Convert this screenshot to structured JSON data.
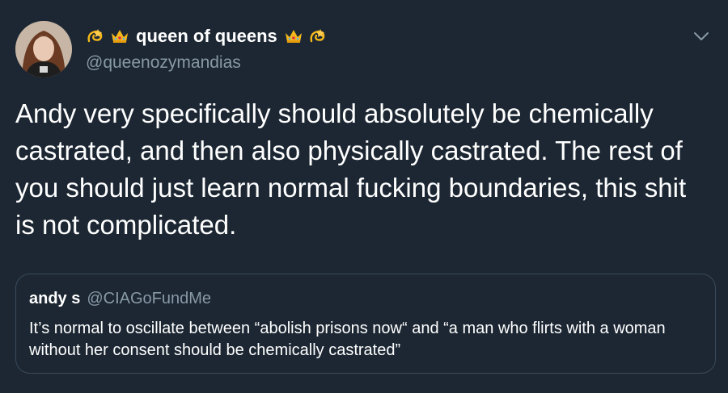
{
  "author": {
    "display_name": "queen of queens",
    "handle": "@queenozymandias",
    "avatar_icon": "profile-photo",
    "name_emojis": [
      "dizzy-star-icon",
      "crown-icon",
      "crown-icon",
      "dizzy-star-icon"
    ]
  },
  "tweet": {
    "text": "Andy very specifically should absolutely be chemically castrated, and then also physically castrated. The rest of you should just learn normal fucking boundaries, this shit is not complicated."
  },
  "quoted_tweet": {
    "display_name": "andy s",
    "handle": "@CIAGoFundMe",
    "text": "It’s normal to oscillate between “abolish prisons now“ and “a man who flirts with a woman without her consent should be chemically castrated”"
  },
  "colors": {
    "background": "#1c2733",
    "text": "#ffffff",
    "secondary_text": "#8899a6",
    "border": "#3a4a5b",
    "crown": "#f5b81b",
    "star": "#f5b81b"
  },
  "icons": {
    "menu": "chevron-down-icon"
  }
}
